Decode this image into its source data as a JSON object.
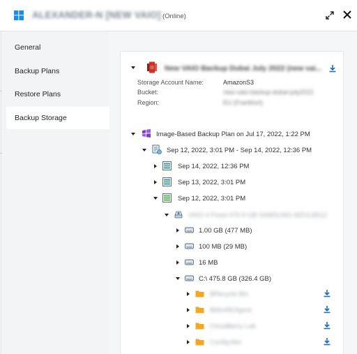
{
  "window": {
    "title": "ALEXANDER-N [NEW VAIO]",
    "status": "(Online)",
    "icons": {
      "app": "windows-icon",
      "expand": "expand-icon",
      "close": "close-icon"
    }
  },
  "sidebar": {
    "items": [
      {
        "label": "General",
        "active": false
      },
      {
        "label": "Backup Plans",
        "active": false
      },
      {
        "label": "Restore Plans",
        "active": false
      },
      {
        "label": "Backup Storage",
        "active": true
      }
    ]
  },
  "storage": {
    "name": "New VAIO Backup Dubai July 2022 (new vai...",
    "icon": "amazon-s3-icon",
    "properties": [
      {
        "label": "Storage Account Name:",
        "value": "AmazonS3",
        "blurred": false
      },
      {
        "label": "Bucket:",
        "value": "new-vaio-backup-dubai-july2022",
        "blurred": true
      },
      {
        "label": "Region:",
        "value": "EU (Frankfurt)",
        "blurred": true
      }
    ]
  },
  "tree": {
    "plan": "Image-Based Backup Plan on Jul 17, 2022, 1:22 PM",
    "range": "Sep 12, 2022, 3:01 PM - Sep 14, 2022, 12:36 PM",
    "restore_points": [
      "Sep 14, 2022, 12:36 PM",
      "Sep 13, 2022, 3:01 PM",
      "Sep 12, 2022, 3:01 PM"
    ],
    "disk_name": "VAIO 4 Fixed 476 9 GB SAMSUNG MZVLB512",
    "partitions": [
      "1.00 GB (477 MB)",
      "100 MB (29 MB)",
      "16 MB",
      "C:\\ 475.8 GB (326.4 GB)"
    ],
    "folders": [
      "$Recycle.Bin",
      "$WinREAgent",
      "CloudBerry Lab",
      "Config.Msi"
    ]
  },
  "colors": {
    "accent": "#1a6fc4",
    "folder": "#f5a623",
    "s3": "#c7352b",
    "plan_icon": "#7b3fbe",
    "sidebar_bg": "#f3f4f5",
    "content_bg": "#f5f6f7"
  }
}
